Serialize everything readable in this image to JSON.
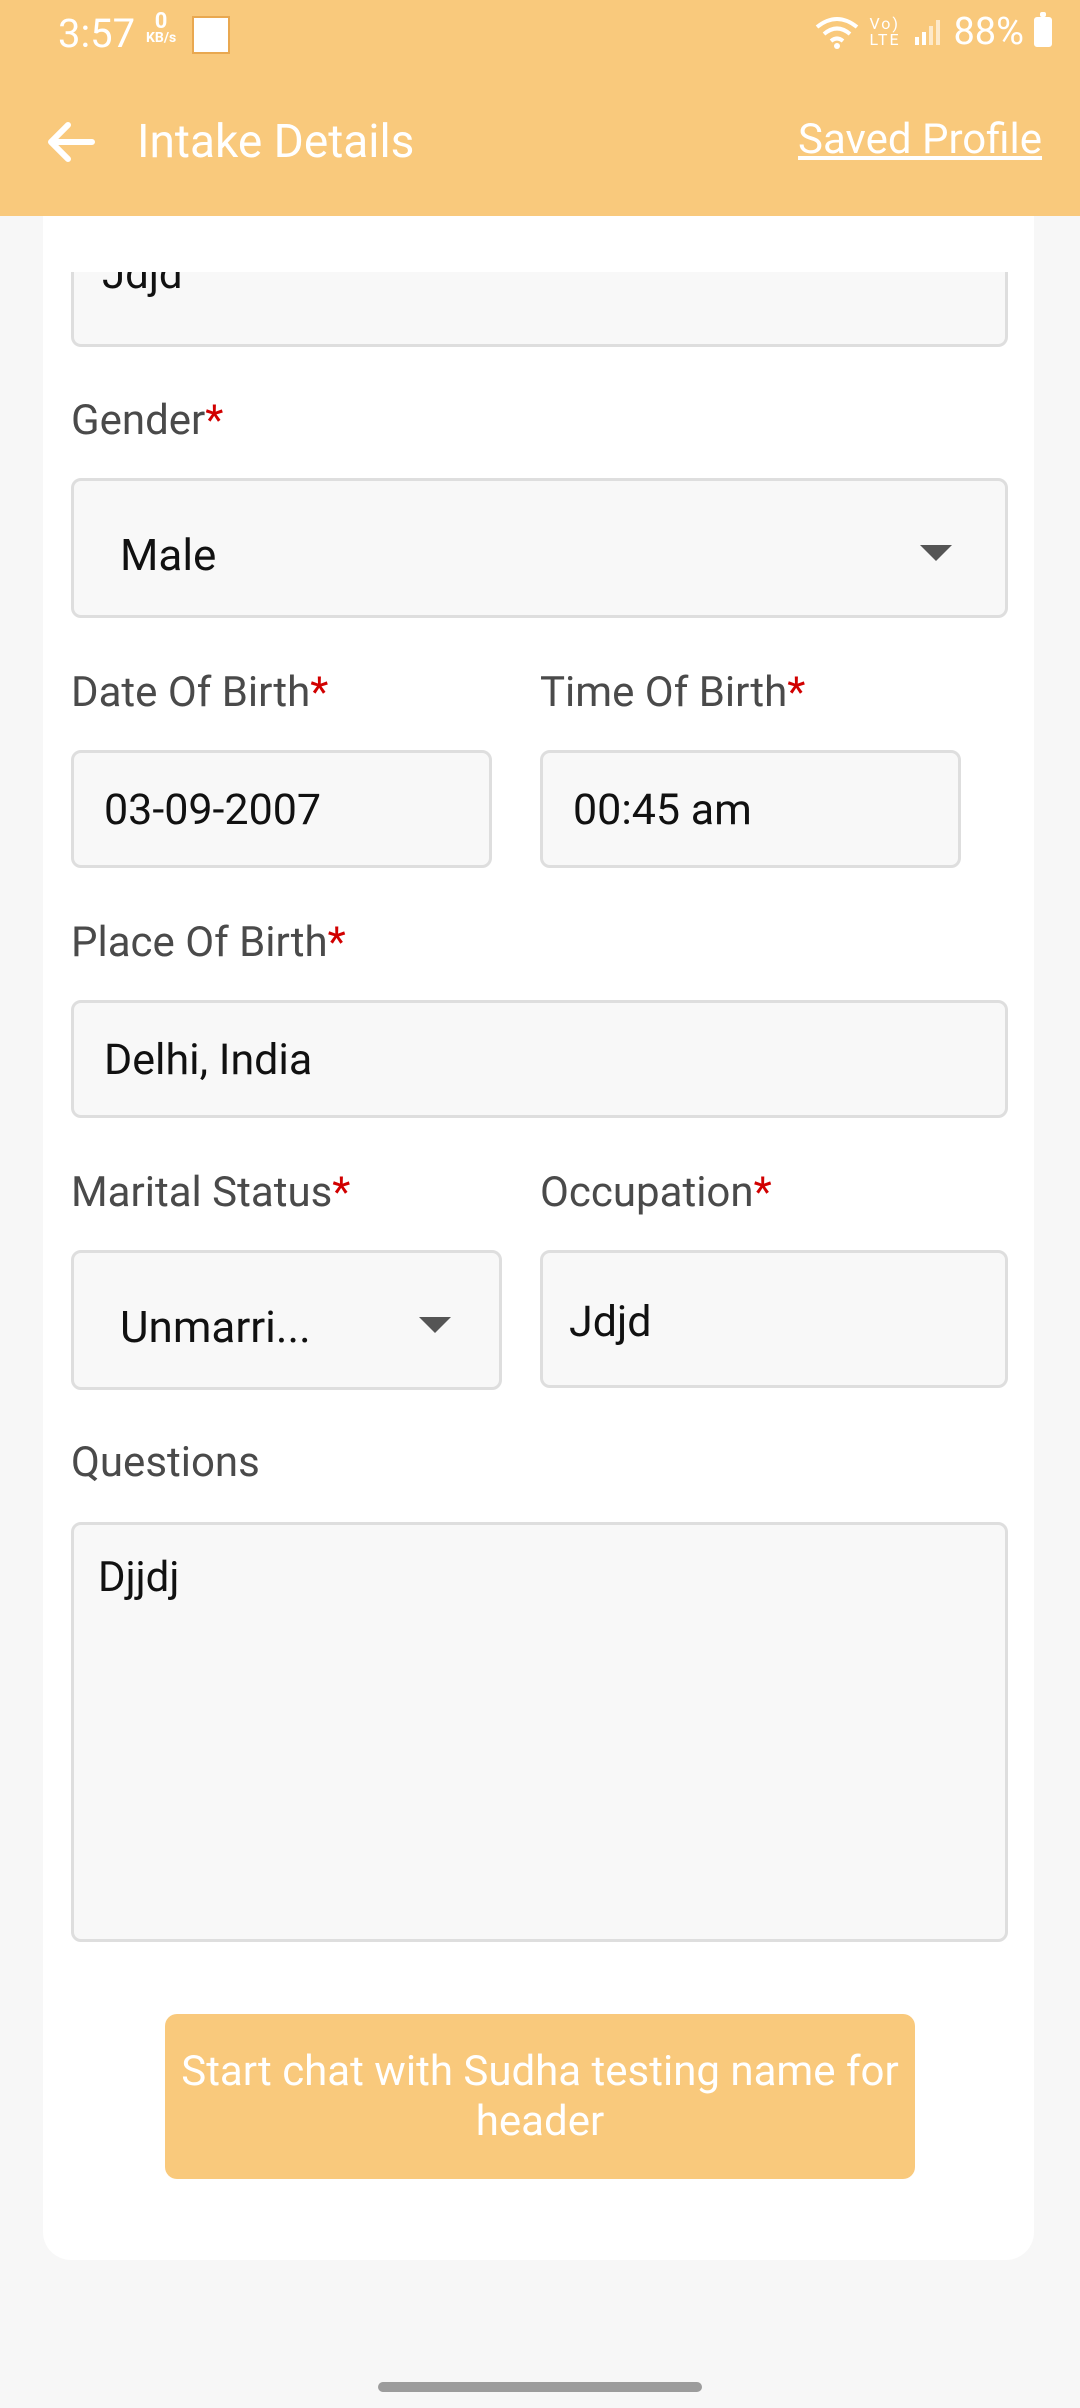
{
  "status_bar": {
    "time": "3:57",
    "net_speed_value": "0",
    "net_speed_unit": "KB/s",
    "battery": "88%",
    "signal_label": "Vo) LTE"
  },
  "header": {
    "title": "Intake Details",
    "saved_profile": "Saved Profile",
    "bg_color": "#f9c97c"
  },
  "form": {
    "name_value": "Jdjd",
    "gender": {
      "label": "Gender",
      "value": "Male"
    },
    "dob": {
      "label": "Date Of Birth",
      "value": "03-09-2007"
    },
    "tob": {
      "label": "Time Of Birth",
      "value": "00:45 am"
    },
    "pob": {
      "label": "Place Of Birth",
      "value": "Delhi, India"
    },
    "marital": {
      "label": "Marital Status",
      "value": "Unmarri..."
    },
    "occupation": {
      "label": "Occupation",
      "value": "Jdjd"
    },
    "questions": {
      "label": "Questions",
      "value": "Djjdj"
    },
    "required_mark": "*"
  },
  "cta": {
    "label": "Start chat with Sudha testing name for header"
  }
}
